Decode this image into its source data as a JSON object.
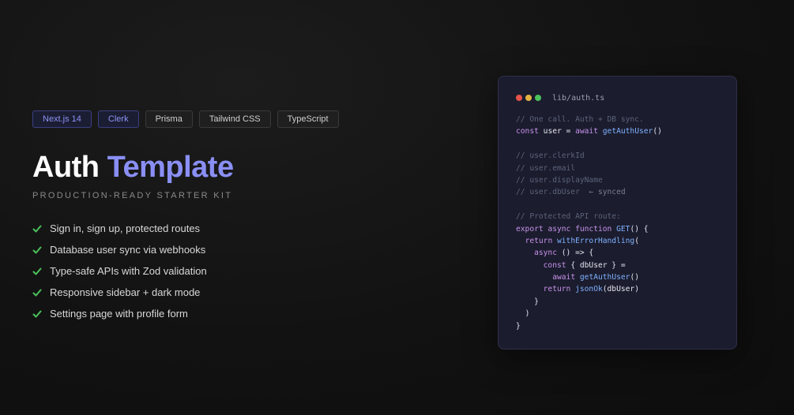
{
  "badges": [
    "Next.js 14",
    "Clerk",
    "Prisma",
    "Tailwind CSS",
    "TypeScript"
  ],
  "title": {
    "word1": "Auth",
    "word2": "Template"
  },
  "subtitle": "PRODUCTION-READY STARTER KIT",
  "features": [
    "Sign in, sign up, protected routes",
    "Database user sync via webhooks",
    "Type-safe APIs with Zod validation",
    "Responsive sidebar + dark mode",
    "Settings page with profile form"
  ],
  "code_card": {
    "filename": "lib/auth.ts",
    "lines": [
      "// One call. Auth + DB sync.",
      "const user = await getAuthUser()",
      "",
      "// user.clerkId",
      "// user.email",
      "// user.displayName",
      "// user.dbUser  ← synced",
      "",
      "// Protected API route:",
      "export async function GET() {",
      "  return withErrorHandling(",
      "    async () => {",
      "      const { dbUser } =",
      "        await getAuthUser()",
      "      return jsonOk(dbUser)",
      "    }",
      "  )",
      "}"
    ]
  },
  "colors": {
    "accent": "#8a8ff5",
    "check": "#4cc25a",
    "card_bg": "#1b1c2e"
  }
}
